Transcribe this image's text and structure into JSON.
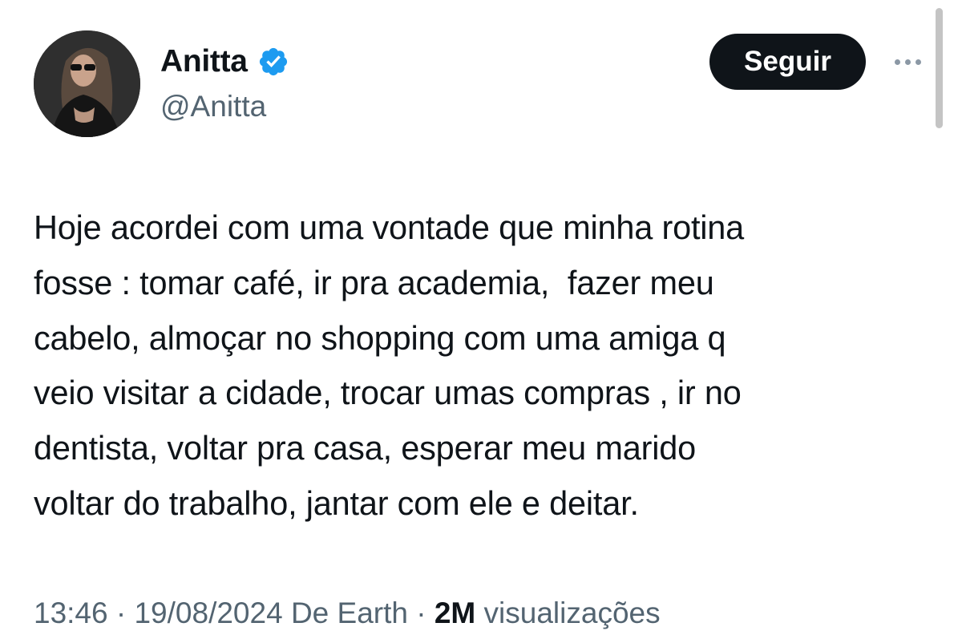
{
  "tweet": {
    "author": {
      "display_name": "Anitta",
      "handle": "@Anitta",
      "verified": true,
      "verified_color": "#1d9bf0"
    },
    "follow_label": "Seguir",
    "more_icon": "ellipsis-icon",
    "text": "Hoje acordei com uma vontade que minha rotina\nfosse : tomar café, ir pra academia,  fazer meu\ncabelo, almoçar no shopping com uma amiga q\nveio visitar a cidade, trocar umas compras , ir no\ndentista, voltar pra casa, esperar meu marido\nvoltar do trabalho, jantar com ele e deitar.",
    "meta": {
      "time": "13:46",
      "separator": "·",
      "date": "19/08/2024",
      "source": "De Earth",
      "views_count": "2M",
      "views_label": "visualizações"
    }
  }
}
